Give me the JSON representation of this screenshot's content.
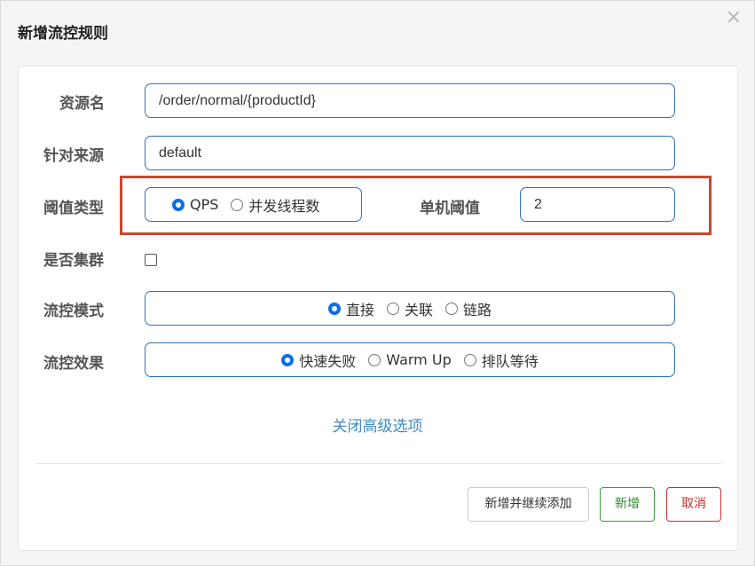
{
  "dialog": {
    "title": "新增流控规则",
    "close_glyph": "×"
  },
  "form": {
    "resource_name": {
      "label": "资源名",
      "value": "/order/normal/{productId}"
    },
    "limit_app": {
      "label": "针对来源",
      "value": "default"
    },
    "threshold_type": {
      "label": "阈值类型",
      "options": [
        "QPS",
        "并发线程数"
      ],
      "selected": "QPS"
    },
    "single_threshold": {
      "label": "单机阈值",
      "value": "2"
    },
    "cluster_mode": {
      "label": "是否集群",
      "checked": false
    },
    "control_mode": {
      "label": "流控模式",
      "options": [
        "直接",
        "关联",
        "链路"
      ],
      "selected": "直接"
    },
    "control_effect": {
      "label": "流控效果",
      "options": [
        "快速失败",
        "Warm Up",
        "排队等待"
      ],
      "selected": "快速失败"
    },
    "advanced_link": "关闭高级选项"
  },
  "footer": {
    "add_continue_label": "新增并继续添加",
    "add_label": "新增",
    "cancel_label": "取消"
  },
  "colors": {
    "highlight": "#c9482e",
    "input_border": "#2f6fb3",
    "link": "#3f8ac4",
    "success": "#2e8a2e",
    "danger": "#c9302c"
  }
}
